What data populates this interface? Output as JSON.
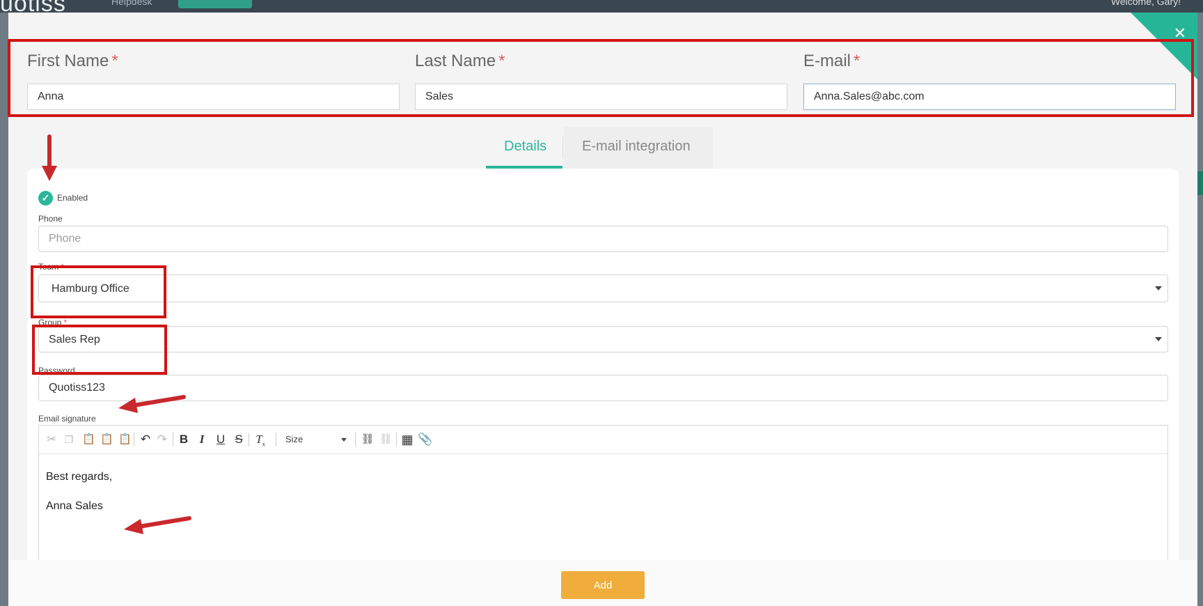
{
  "app": {
    "logo": "uotiss",
    "nav_item": "Helpdesk",
    "welcome": "Welcome, Gary!"
  },
  "modal": {
    "name_fields": [
      {
        "label": "First Name",
        "required_mark": "*",
        "value": "Anna"
      },
      {
        "label": "Last Name",
        "required_mark": "*",
        "value": "Sales"
      },
      {
        "label": "E-mail",
        "required_mark": "*",
        "value": "Anna.Sales@abc.com"
      }
    ],
    "tabs": [
      {
        "label": "Details",
        "active": true
      },
      {
        "label": "E-mail integration",
        "active": false
      }
    ],
    "details": {
      "enabled_label": "Enabled",
      "enabled_checked": true,
      "phone": {
        "label": "Phone",
        "placeholder": "Phone",
        "value": ""
      },
      "team": {
        "label": "Team",
        "required_mark": "*",
        "value": "Hamburg Office"
      },
      "group": {
        "label": "Group",
        "required_mark": "*",
        "value": "Sales Rep"
      },
      "password": {
        "label": "Password",
        "value": "Quotiss123"
      },
      "email_signature": {
        "label": "Email signature",
        "size_select": "Size",
        "lines": [
          "Best regards,",
          "Anna Sales"
        ]
      }
    },
    "add_button": "Add"
  },
  "colors": {
    "accent": "#2bb79b",
    "button": "#f0ad3c",
    "annotation": "#d11414",
    "required": "#e05c5c"
  }
}
